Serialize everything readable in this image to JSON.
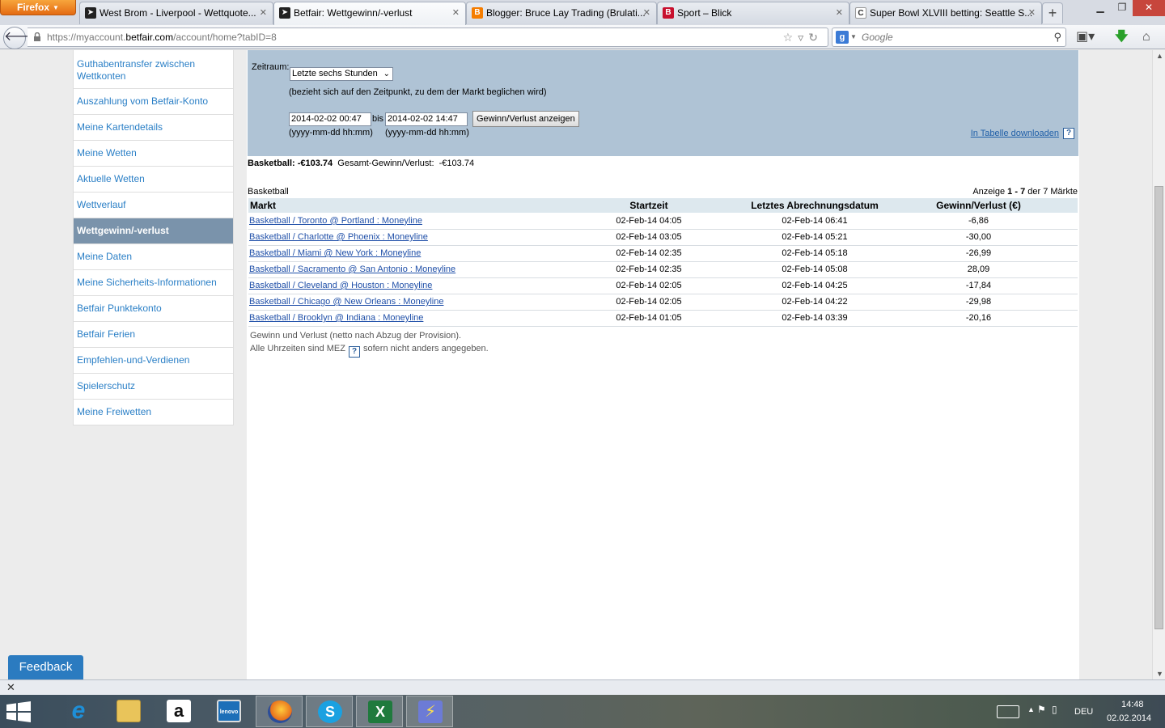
{
  "browser": {
    "menu_label": "Firefox",
    "tabs": [
      {
        "title": "West Brom - Liverpool - Wettquote...",
        "favicon": "betfair-icon",
        "active": false
      },
      {
        "title": "Betfair: Wettgewinn/-verlust",
        "favicon": "betfair-icon",
        "active": true
      },
      {
        "title": "Blogger: Bruce Lay Trading (Brulati...",
        "favicon": "blogger-icon",
        "active": false
      },
      {
        "title": "Sport – Blick",
        "favicon": "blick-icon",
        "active": false
      },
      {
        "title": "Super Bowl XLVIII betting: Seattle S...",
        "favicon": "site-icon",
        "active": false
      }
    ],
    "url_prefix": "https://myaccount.",
    "url_host": "betfair.com",
    "url_path": "/account/home?tabID=8",
    "search_placeholder": "Google",
    "colors": {
      "firefox_orange": "#e46b12",
      "close_red": "#c7463c"
    }
  },
  "sidebar": {
    "items": [
      {
        "label": "Guthabentransfer zwischen Wettkonten",
        "active": false
      },
      {
        "label": "Auszahlung vom Betfair-Konto",
        "active": false
      },
      {
        "label": "Meine Kartendetails",
        "active": false
      },
      {
        "label": "Meine Wetten",
        "active": false
      },
      {
        "label": "Aktuelle Wetten",
        "active": false
      },
      {
        "label": "Wettverlauf",
        "active": false
      },
      {
        "label": "Wettgewinn/-verlust",
        "active": true
      },
      {
        "label": "Meine Daten",
        "active": false
      },
      {
        "label": "Meine Sicherheits-Informationen",
        "active": false
      },
      {
        "label": "Betfair Punktekonto",
        "active": false
      },
      {
        "label": "Betfair Ferien",
        "active": false
      },
      {
        "label": "Empfehlen-und-Verdienen",
        "active": false
      },
      {
        "label": "Spielerschutz",
        "active": false
      },
      {
        "label": "Meine Freiwetten",
        "active": false
      }
    ],
    "colors": {
      "link": "#2a7fc6",
      "active_bg": "#7a93ab"
    }
  },
  "filter": {
    "zeitraum_label": "Zeitraum:",
    "zeitraum_value": "Letzte sechs Stunden",
    "zeitraum_note": "(bezieht sich auf den Zeitpunkt, zu dem der Markt beglichen wird)",
    "from_value": "2014-02-02 00:47",
    "bis_label": "bis",
    "to_value": "2014-02-02 14:47",
    "show_button": "Gewinn/Verlust anzeigen",
    "format_hint": "(yyyy-mm-dd hh:mm)",
    "download_link": "In Tabelle downloaden",
    "help_glyph": "?",
    "colors": {
      "panel_bg": "#afc3d5"
    }
  },
  "summary": {
    "sport_total": "Basketball: -€103.74",
    "overall_label": "Gesamt-Gewinn/Verlust:",
    "overall_value": "-€103.74"
  },
  "table": {
    "caption": "Basketball",
    "pager_prefix": "Anzeige",
    "pager_from": "1",
    "pager_sep": "-",
    "pager_to": "7",
    "pager_suffix": "der 7 Märkte",
    "headers": {
      "markt": "Markt",
      "startzeit": "Startzeit",
      "abrechnung": "Letztes Abrechnungsdatum",
      "gewinn": "Gewinn/Verlust (€)"
    },
    "rows": [
      {
        "markt": "Basketball / Toronto @ Portland : Moneyline",
        "start": "02-Feb-14 04:05",
        "settled": "02-Feb-14 06:41",
        "pl": "-6,86"
      },
      {
        "markt": "Basketball / Charlotte @ Phoenix : Moneyline",
        "start": "02-Feb-14 03:05",
        "settled": "02-Feb-14 05:21",
        "pl": "-30,00"
      },
      {
        "markt": "Basketball / Miami @ New York : Moneyline",
        "start": "02-Feb-14 02:35",
        "settled": "02-Feb-14 05:18",
        "pl": "-26,99"
      },
      {
        "markt": "Basketball / Sacramento @ San Antonio : Moneyline",
        "start": "02-Feb-14 02:35",
        "settled": "02-Feb-14 05:08",
        "pl": "28,09"
      },
      {
        "markt": "Basketball / Cleveland @ Houston : Moneyline",
        "start": "02-Feb-14 02:05",
        "settled": "02-Feb-14 04:25",
        "pl": "-17,84"
      },
      {
        "markt": "Basketball / Chicago @ New Orleans : Moneyline",
        "start": "02-Feb-14 02:05",
        "settled": "02-Feb-14 04:22",
        "pl": "-29,98"
      },
      {
        "markt": "Basketball / Brooklyn @ Indiana : Moneyline",
        "start": "02-Feb-14 01:05",
        "settled": "02-Feb-14 03:39",
        "pl": "-20,16"
      }
    ]
  },
  "footnotes": {
    "line1": "Gewinn und Verlust (netto nach Abzug der Provision).",
    "line2_prefix": "Alle Uhrzeiten sind MEZ",
    "line2_suffix": "sofern nicht anders angegeben."
  },
  "feedback_label": "Feedback",
  "taskbar": {
    "apps": [
      {
        "name": "internet-explorer-icon",
        "glyph": "e",
        "color": "#1e8fd8",
        "running": false
      },
      {
        "name": "file-explorer-icon",
        "glyph": "",
        "color": "#e9c45a",
        "running": false
      },
      {
        "name": "amazon-icon",
        "glyph": "a",
        "color": "#ffffff",
        "running": false
      },
      {
        "name": "lenovo-icon",
        "glyph": "lenovo",
        "color": "#1d6fb8",
        "running": false
      },
      {
        "name": "firefox-icon",
        "glyph": "",
        "color": "#e8711c",
        "running": true
      },
      {
        "name": "skype-icon",
        "glyph": "S",
        "color": "#1aa1e1",
        "running": true
      },
      {
        "name": "excel-icon",
        "glyph": "X",
        "color": "#1f7a3d",
        "running": true
      },
      {
        "name": "power-tool-icon",
        "glyph": "⚡",
        "color": "#6c7bd6",
        "running": true
      }
    ],
    "language": "DEU",
    "time": "14:48",
    "date": "02.02.2014"
  }
}
